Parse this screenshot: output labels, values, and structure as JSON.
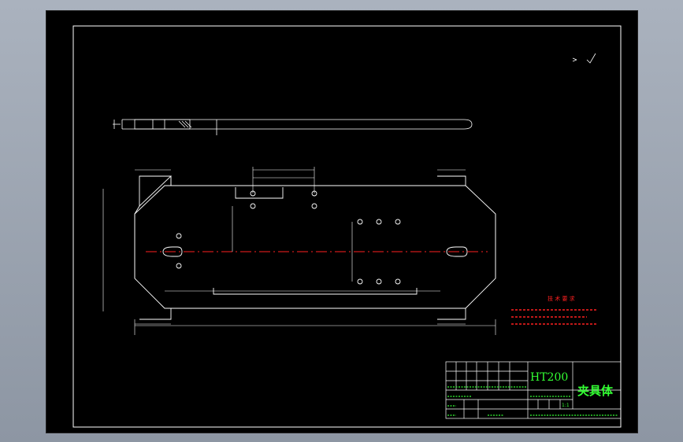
{
  "drawing": {
    "material": "HT200",
    "part_name": "夹具体",
    "scale": "1:1",
    "technical_requirements": {
      "title": "技 术 要 求"
    }
  },
  "colors": {
    "background": "#000000",
    "lines": "#ffffff",
    "centerline": "#ff2020",
    "notes": "#ff2020",
    "title_text": "#33ff33"
  }
}
